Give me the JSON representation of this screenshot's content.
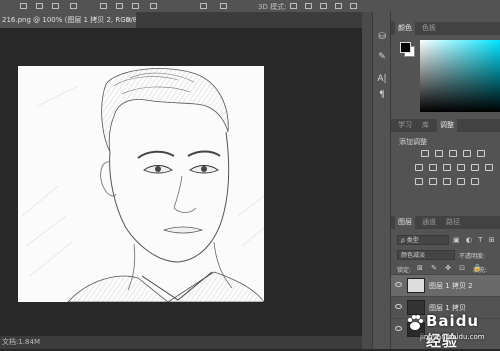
{
  "options_bar": {
    "mode_label": "3D 模式:",
    "icons": [
      "align-left-icon",
      "align-center-icon",
      "align-right-icon",
      "distribute-icon",
      "align-top-icon",
      "align-middle-icon",
      "align-bottom-icon",
      "distribute-vertical-icon"
    ]
  },
  "document": {
    "tab_title": "216.png @ 100% (图层 1 拷贝 2, RGB/8) *",
    "close_glyph": "×",
    "status": "文档:1.84M"
  },
  "toolstrip": {
    "icons": [
      "history-icon",
      "brush-icon",
      "character-icon",
      "paragraph-icon"
    ],
    "glyphs": [
      "⛁",
      "✎",
      "A|",
      "¶"
    ]
  },
  "color_panel": {
    "tabs": [
      "颜色",
      "色板"
    ],
    "active_tab": 0,
    "foreground": "#000000",
    "background": "#ffffff"
  },
  "adjust_panel": {
    "tabs": [
      "学习",
      "库",
      "调整"
    ],
    "active_tab": 2,
    "heading": "添加调整"
  },
  "layers_panel": {
    "tabs": [
      "图层",
      "通道",
      "路径"
    ],
    "active_tab": 0,
    "filter_label": "ρ 类型",
    "blend_mode": "颜色减淡",
    "opacity_label": "不透明度:",
    "lock_label": "锁定:",
    "fill_label": "填充:",
    "layers": [
      {
        "name": "图层 1 拷贝 2",
        "selected": true
      },
      {
        "name": "图层 1 拷贝",
        "selected": false
      },
      {
        "name": "",
        "selected": false
      }
    ]
  },
  "watermark": {
    "text": "Baidu 经验",
    "url": "jingyan.baidu.com"
  }
}
